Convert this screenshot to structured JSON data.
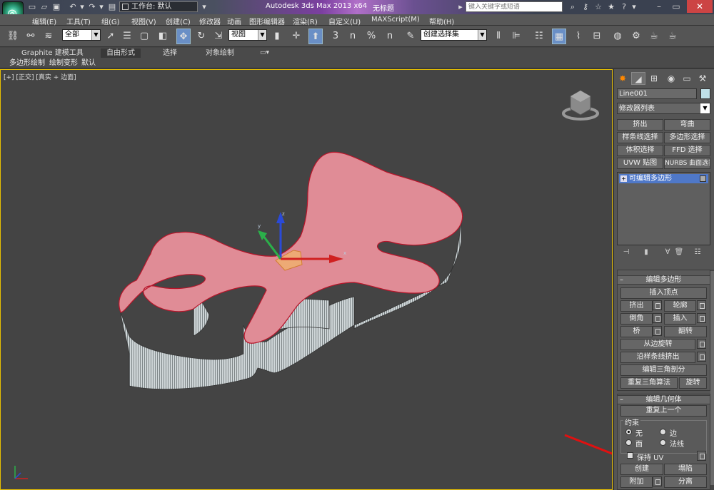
{
  "titlebar": {
    "workspace": "工作台: 默认",
    "app_title": "Autodesk 3ds Max  2013 x64",
    "document": "无标题",
    "search_placeholder": "键入关键字或短语"
  },
  "menu": [
    "编辑(E)",
    "工具(T)",
    "组(G)",
    "视图(V)",
    "创建(C)",
    "修改器",
    "动画",
    "图形编辑器",
    "渲染(R)",
    "自定义(U)",
    "MAXScript(M)",
    "帮助(H)"
  ],
  "toolbar": {
    "selection_filter": "全部",
    "ref_coord": "视图",
    "snap_labels": [
      "3",
      "n",
      "%",
      "n"
    ],
    "named_sel_set": "创建选择集"
  },
  "ribbon": {
    "tabs": [
      "Graphite 建模工具",
      "自由形式",
      "选择",
      "对象绘制"
    ],
    "subtabs": [
      "多边形绘制",
      "绘制变形",
      "默认"
    ]
  },
  "viewport": {
    "label_plus": "[+]",
    "label_view": "[正交]",
    "label_shading": "[真实 + 边面]",
    "gizmo_axes": [
      "x",
      "y",
      "z"
    ],
    "shape_color": "#e08c96",
    "selection_color": "#e89c9c"
  },
  "command_panel": {
    "object_name": "Line001",
    "object_color": "#bfe0e8",
    "modifier_list": "修改器列表",
    "quick_buttons": [
      "挤出",
      "弯曲",
      "样条线选择",
      "多边形选择",
      "体积选择",
      "FFD 选择",
      "UVW 贴图",
      "NURBS 曲面选择"
    ],
    "stack_item": "可编辑多边形",
    "rollout_edit_poly": {
      "title": "编辑多边形",
      "insert_vertex": "插入顶点",
      "extrude": "挤出",
      "outline": "轮廓",
      "bevel": "倒角",
      "inset": "插入",
      "bridge": "桥",
      "flip": "翻转",
      "hinge": "从边旋转",
      "extrude_spline": "沿样条线挤出",
      "edit_tri": "编辑三角剖分",
      "retriangulate": "重复三角算法",
      "turn": "旋转"
    },
    "rollout_edit_geo": {
      "title": "编辑几何体",
      "repeat_last": "重复上一个",
      "constraints": "约束",
      "opt_none": "无",
      "opt_edge": "边",
      "opt_face": "面",
      "opt_normal": "法线",
      "preserve_uv": "保持 UV",
      "create": "创建",
      "collapse": "塌陷",
      "attach": "附加",
      "detach": "分离"
    }
  },
  "annotation_color": "#e01010"
}
